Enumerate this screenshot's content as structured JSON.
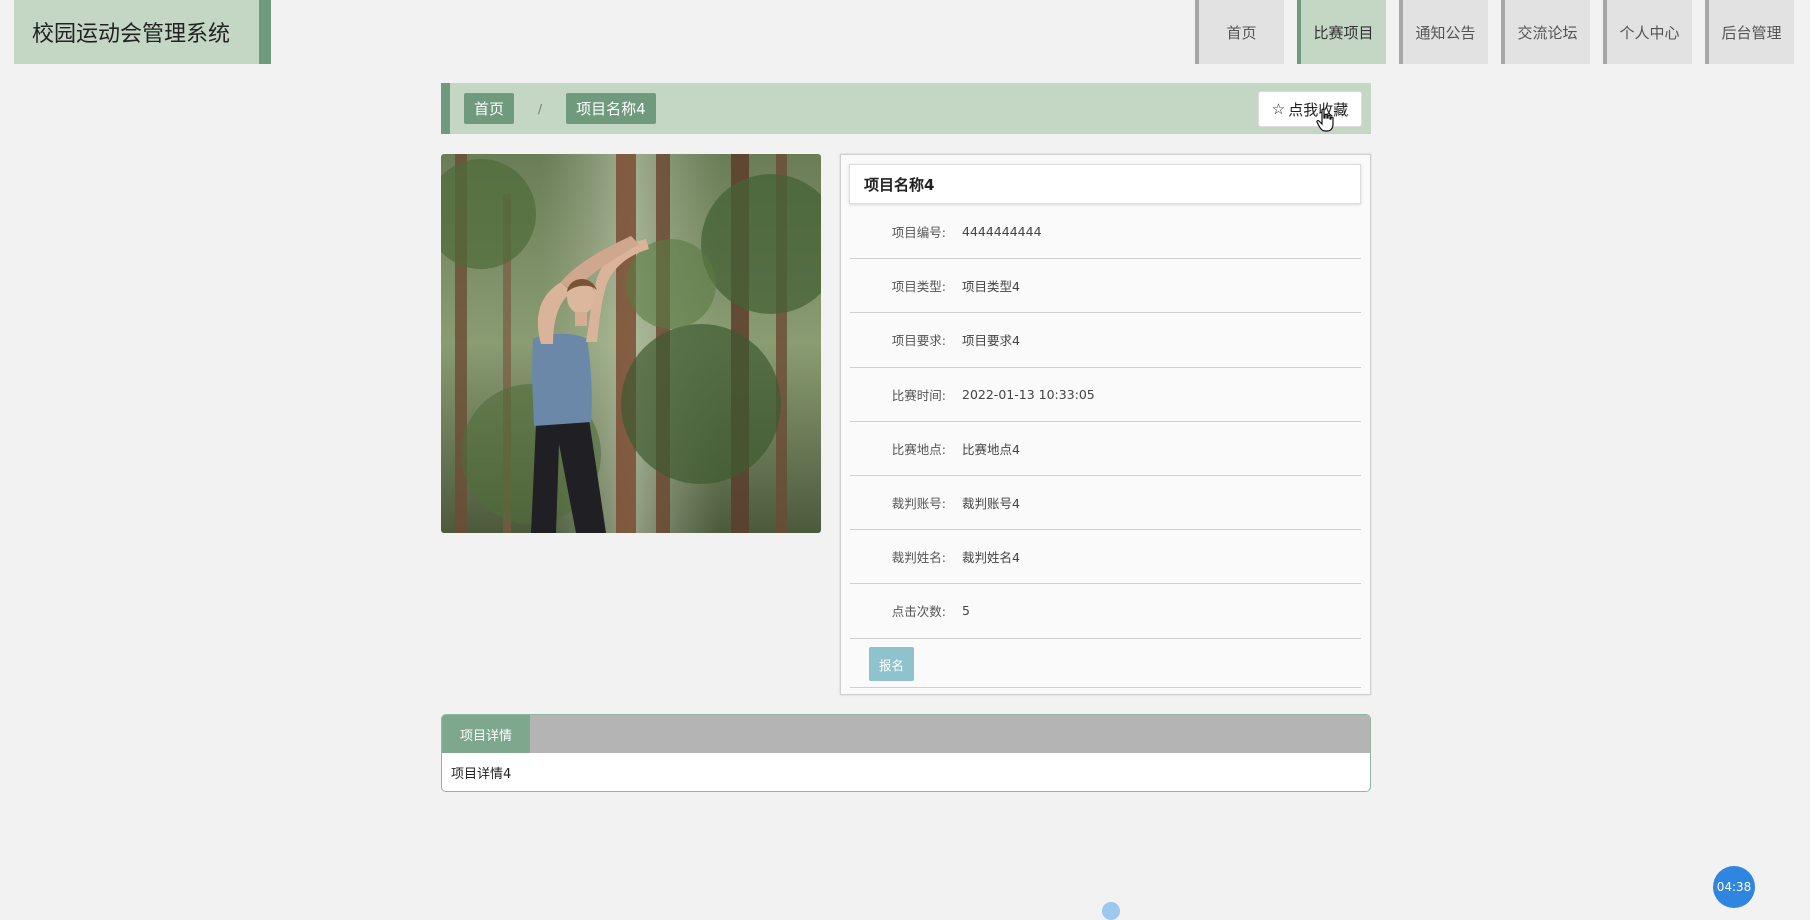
{
  "app": {
    "title": "校园运动会管理系统"
  },
  "nav": {
    "items": [
      {
        "label": "首页",
        "active": false
      },
      {
        "label": "比赛项目",
        "active": true
      },
      {
        "label": "通知公告",
        "active": false
      },
      {
        "label": "交流论坛",
        "active": false
      },
      {
        "label": "个人中心",
        "active": false
      },
      {
        "label": "后台管理",
        "active": false
      }
    ]
  },
  "breadcrumb": {
    "home": "首页",
    "separator": "/",
    "current": "项目名称4"
  },
  "favorite": {
    "icon": "star-outline-icon",
    "label": "点我收藏"
  },
  "detail": {
    "title": "项目名称4",
    "fields": [
      {
        "label": "项目编号:",
        "value": "4444444444"
      },
      {
        "label": "项目类型:",
        "value": "项目类型4"
      },
      {
        "label": "项目要求:",
        "value": "项目要求4"
      },
      {
        "label": "比赛时间:",
        "value": "2022-01-13 10:33:05"
      },
      {
        "label": "比赛地点:",
        "value": "比赛地点4"
      },
      {
        "label": "裁判账号:",
        "value": "裁判账号4"
      },
      {
        "label": "裁判姓名:",
        "value": "裁判姓名4"
      },
      {
        "label": "点击次数:",
        "value": "5"
      }
    ],
    "signup_label": "报名"
  },
  "tabs": {
    "active_label": "项目详情",
    "content": "项目详情4"
  },
  "timer": {
    "label": "04:38"
  },
  "colors": {
    "accent": "#6f9a7e",
    "accent_light": "#c4d6c4",
    "signup": "#8ec2cc",
    "timer": "#2f86e0"
  }
}
